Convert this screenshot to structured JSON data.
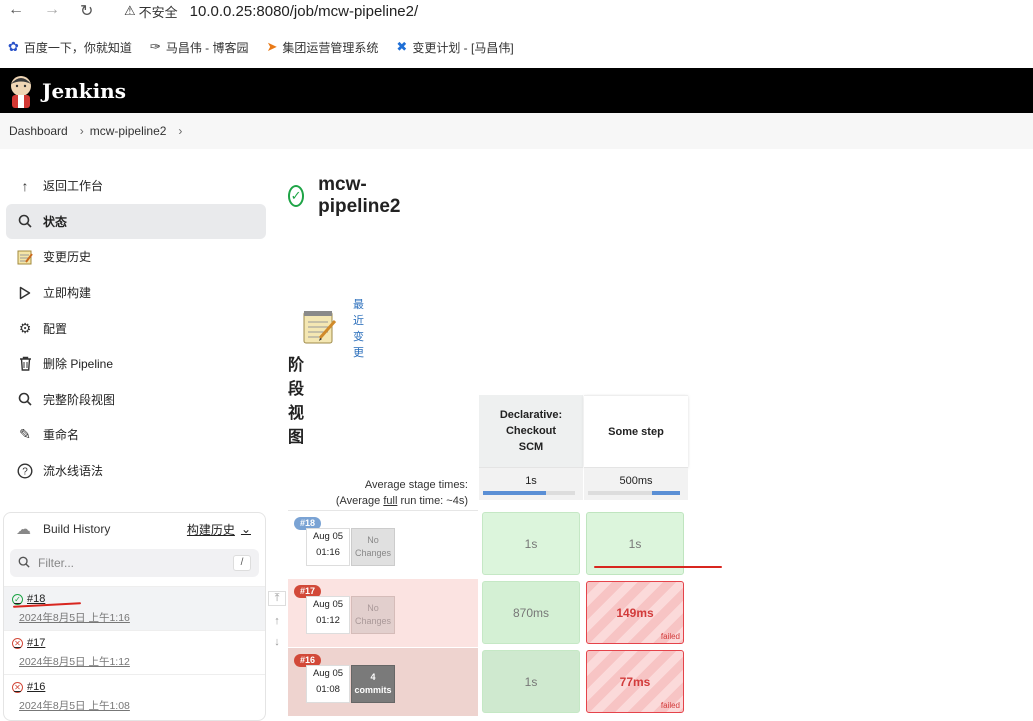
{
  "browser": {
    "security_label": "不安全",
    "url": "10.0.0.25:8080/job/mcw-pipeline2/",
    "bookmarks": [
      {
        "icon": "paw-icon",
        "label": "百度一下，你就知道"
      },
      {
        "icon": "pen-icon",
        "label": "马昌伟 - 博客园"
      },
      {
        "icon": "flag-icon",
        "label": "集团运营管理系统"
      },
      {
        "icon": "x-logo-icon",
        "label": "变更计划 - [马昌伟]"
      }
    ]
  },
  "header": {
    "title": "Jenkins"
  },
  "breadcrumb": [
    "Dashboard",
    "mcw-pipeline2"
  ],
  "sidebar": {
    "items": [
      {
        "icon": "arrow-up-icon",
        "label": "返回工作台"
      },
      {
        "icon": "search-icon",
        "label": "状态"
      },
      {
        "icon": "notepad-icon",
        "label": "变更历史"
      },
      {
        "icon": "play-icon",
        "label": "立即构建"
      },
      {
        "icon": "gear-icon",
        "label": "配置"
      },
      {
        "icon": "trash-icon",
        "label": "删除 Pipeline"
      },
      {
        "icon": "search-icon",
        "label": "完整阶段视图"
      },
      {
        "icon": "pencil-icon",
        "label": "重命名"
      },
      {
        "icon": "help-icon",
        "label": "流水线语法"
      }
    ]
  },
  "build_history": {
    "title": "Build History",
    "trend_label": "构建历史",
    "filter_placeholder": "Filter...",
    "filter_shortcut": "/",
    "builds": [
      {
        "number": "#18",
        "status": "success",
        "date": "2024年8月5日 上午1:16"
      },
      {
        "number": "#17",
        "status": "failed",
        "date": "2024年8月5日 上午1:12"
      },
      {
        "number": "#16",
        "status": "failed",
        "date": "2024年8月5日 上午1:08"
      }
    ]
  },
  "job": {
    "title": "mcw-pipeline2",
    "recent_changes": "最近变更",
    "stage_view_heading": "阶段视图"
  },
  "stage_view": {
    "avg_label": "Average stage times:",
    "avg_full_prefix": "(Average ",
    "avg_full_link": "full",
    "avg_full_suffix": " run time: ~4s)",
    "stages": [
      {
        "name_lines": [
          "Declarative:",
          "Checkout",
          "SCM"
        ],
        "avg": "1s",
        "avg_fraction": 0.68
      },
      {
        "name_lines": [
          "Some step"
        ],
        "avg": "500ms",
        "avg_fraction": 0.3
      }
    ],
    "runs": [
      {
        "badge": "#18",
        "status": "success",
        "date": "Aug 05",
        "time": "01:16",
        "changes": [
          "No",
          "Changes"
        ],
        "commits": false,
        "cells": [
          {
            "value": "1s",
            "status": "success"
          },
          {
            "value": "1s",
            "status": "success"
          }
        ]
      },
      {
        "badge": "#17",
        "status": "failed",
        "date": "Aug 05",
        "time": "01:12",
        "changes": [
          "No",
          "Changes"
        ],
        "commits": false,
        "cells": [
          {
            "value": "870ms",
            "status": "success"
          },
          {
            "value": "149ms",
            "status": "failed",
            "label": "failed"
          }
        ]
      },
      {
        "badge": "#16",
        "status": "failed",
        "date": "Aug 05",
        "time": "01:08",
        "changes": [
          "4",
          "commits"
        ],
        "commits": true,
        "cells": [
          {
            "value": "1s",
            "status": "success"
          },
          {
            "value": "77ms",
            "status": "failed",
            "label": "failed"
          }
        ]
      }
    ]
  },
  "colors": {
    "success": "#1ea446",
    "failed": "#d24939",
    "link": "#2a6ebb",
    "annotation": "#d8261f"
  }
}
